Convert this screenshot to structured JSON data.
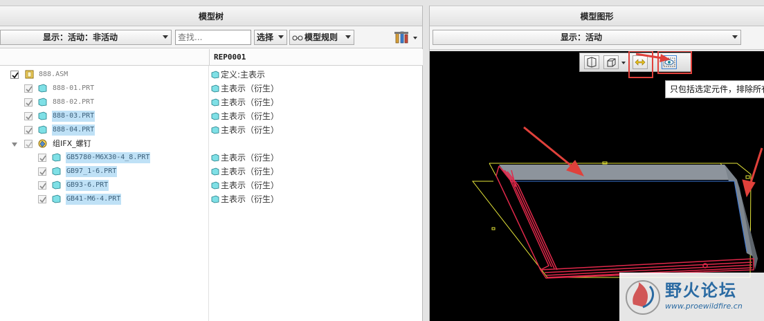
{
  "left_panel": {
    "title": "模型树",
    "display_label": "显示：活动：非活动",
    "search_placeholder": "查找...",
    "select_label": "选择",
    "rules_label": "模型规则",
    "column_header": "REP0001"
  },
  "tree": [
    {
      "name": "888.ASM",
      "rep": "定义:主表示",
      "selected": false,
      "checked": true,
      "type": "assembly"
    },
    {
      "name": "888-01.PRT",
      "rep": "主表示（衍生）",
      "selected": false,
      "checked": true,
      "type": "part"
    },
    {
      "name": "888-02.PRT",
      "rep": "主表示（衍生）",
      "selected": false,
      "checked": true,
      "type": "part"
    },
    {
      "name": "888-03.PRT",
      "rep": "主表示（衍生）",
      "selected": true,
      "checked": true,
      "type": "part"
    },
    {
      "name": "888-04.PRT",
      "rep": "主表示（衍生）",
      "selected": true,
      "checked": true,
      "type": "part"
    },
    {
      "name": "组IFX_螺钉",
      "rep": "",
      "selected": false,
      "checked": true,
      "type": "group"
    },
    {
      "name": "GB5780-M6X30-4_8.PRT",
      "rep": "主表示（衍生）",
      "selected": true,
      "checked": true,
      "type": "part"
    },
    {
      "name": "GB97_1-6.PRT",
      "rep": "主表示（衍生）",
      "selected": true,
      "checked": true,
      "type": "part"
    },
    {
      "name": "GB93-6.PRT",
      "rep": "主表示（衍生）",
      "selected": true,
      "checked": true,
      "type": "part"
    },
    {
      "name": "GB41-M6-4.PRT",
      "rep": "主表示（衍生）",
      "selected": true,
      "checked": true,
      "type": "part"
    }
  ],
  "right_panel": {
    "title": "模型图形",
    "display_label": "显示：活动",
    "tooltip": "只包括选定元件，排除所有"
  },
  "watermark": {
    "text": "野火论坛",
    "url": "www.proewildfire.cn"
  },
  "colors": {
    "selection": "#bfe1f6",
    "highlight": "#e0413b",
    "part_icon": "#7fe0e6"
  }
}
